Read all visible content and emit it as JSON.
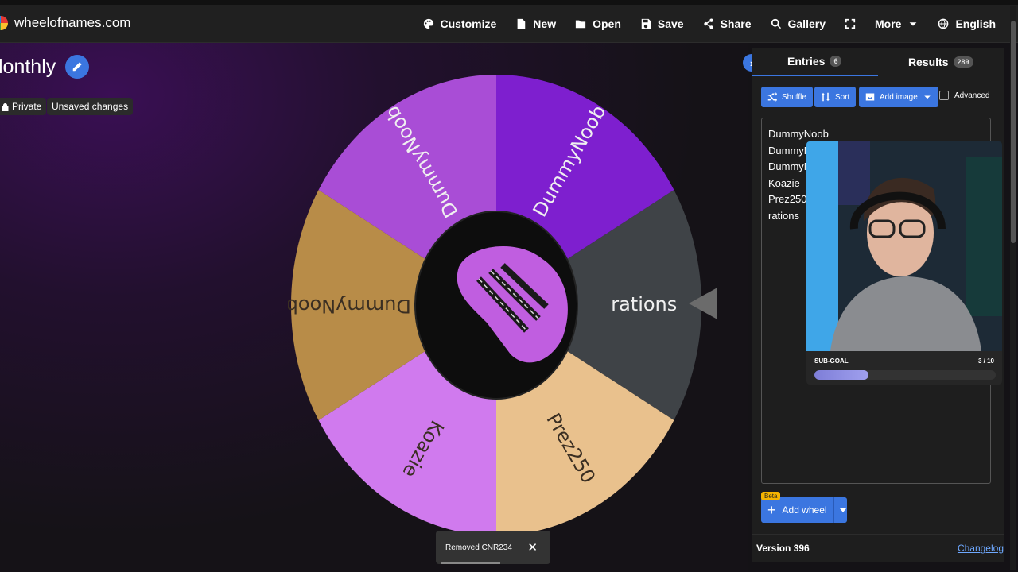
{
  "header": {
    "logo_text": "wheelofnames.com",
    "menu": [
      {
        "label": "Customize",
        "icon": "palette-icon"
      },
      {
        "label": "New",
        "icon": "file-icon"
      },
      {
        "label": "Open",
        "icon": "folder-icon"
      },
      {
        "label": "Save",
        "icon": "save-icon"
      },
      {
        "label": "Share",
        "icon": "share-icon"
      },
      {
        "label": "Gallery",
        "icon": "search-icon"
      },
      {
        "label": "",
        "icon": "fullscreen-icon"
      },
      {
        "label": "More",
        "icon": "chevron-down-icon"
      },
      {
        "label": "English",
        "icon": "globe-icon"
      }
    ]
  },
  "wheel": {
    "title": "lonthly",
    "privacy": "Private",
    "status": "Unsaved changes",
    "segments": [
      {
        "label": "rations",
        "color": "#3f4347"
      },
      {
        "label": "Prez250",
        "color": "#e9c18d"
      },
      {
        "label": "Koazie",
        "color": "#d07aee"
      },
      {
        "label": "DummyNoob",
        "color": "#b88c48"
      },
      {
        "label": "DummyNoob",
        "color": "#a94dd6"
      },
      {
        "label": "DummyNoob",
        "color": "#7e1fcf"
      }
    ]
  },
  "panel": {
    "tabs": [
      {
        "label": "Entries",
        "count": "6"
      },
      {
        "label": "Results",
        "count": "289"
      }
    ],
    "buttons": {
      "shuffle": "Shuffle",
      "sort": "Sort",
      "add_image": "Add image",
      "advanced": "Advanced"
    },
    "entries": [
      "DummyNoob",
      "DummyN",
      "DummyN",
      "Koazie",
      "Prez250",
      "rations"
    ],
    "beta": "Beta",
    "add_wheel": "Add wheel",
    "version": "Version 396",
    "changelog": "Changelog"
  },
  "overlay": {
    "subgoal_label": "SUB-GOAL",
    "subgoal_value": "3 / 10",
    "subgoal_progress": 0.3
  },
  "toast": {
    "message": "Removed CNR234",
    "close": "✕"
  },
  "colors": {
    "accent": "#3b76e0",
    "pointer": "#6b6b6b"
  }
}
